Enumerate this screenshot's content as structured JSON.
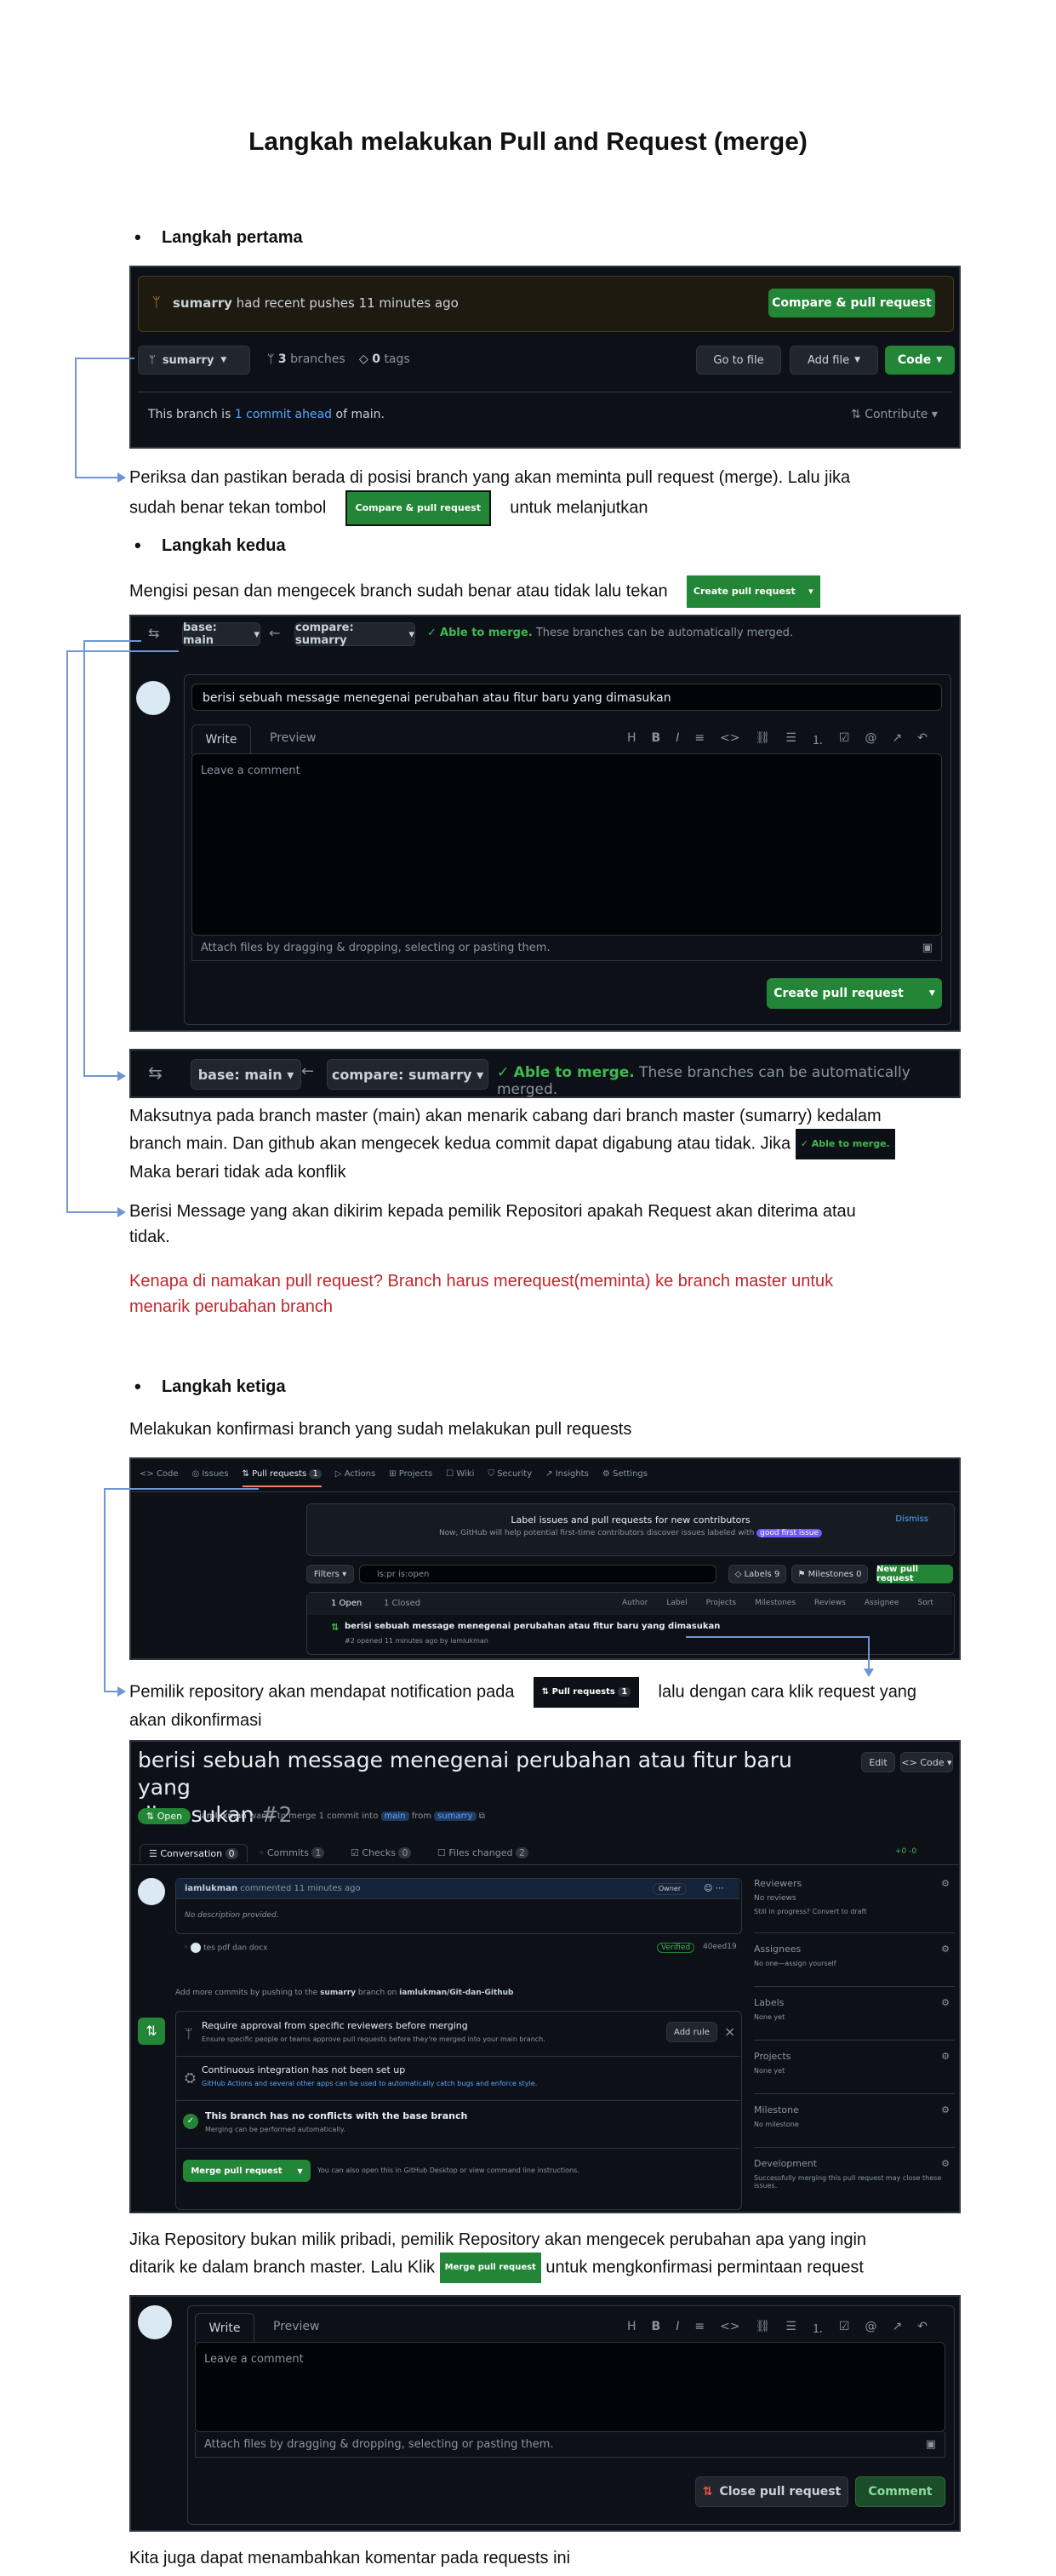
{
  "title": "Langkah melakukan Pull and Request (merge)",
  "step1": {
    "heading": "Langkah pertama",
    "screenshot": {
      "banner_branch": "sumarry",
      "banner_text": "had recent pushes 11 minutes ago",
      "compare_btn": "Compare & pull request",
      "branch_btn": "sumarry",
      "branches_count": "3",
      "branches_label": "branches",
      "tags_count": "0",
      "tags_label": "tags",
      "goto_file": "Go to file",
      "add_file": "Add file",
      "code_btn": "Code",
      "ahead_prefix": "This branch is",
      "ahead_link": "1 commit ahead",
      "ahead_suffix": "of main.",
      "contribute": "Contribute"
    },
    "desc_1": "Periksa dan pastikan berada di posisi branch yang akan meminta pull request (merge). Lalu jika",
    "desc_2a": "sudah benar tekan tombol",
    "inline_btn": "Compare & pull request",
    "desc_2b": "untuk melanjutkan"
  },
  "step2": {
    "heading": "Langkah kedua",
    "intro": "Mengisi pesan dan mengecek branch sudah benar atau tidak lalu tekan",
    "inline_btn": "Create pull request",
    "screenshot": {
      "base": "base: main",
      "compare": "compare: sumarry",
      "able": "Able to merge.",
      "able_rest": "These branches can be automatically merged.",
      "title_value": "berisi sebuah message menegenai perubahan atau fitur baru yang dimasukan",
      "tab_write": "Write",
      "tab_preview": "Preview",
      "placeholder": "Leave a comment",
      "attach": "Attach files by dragging & dropping, selecting or pasting them.",
      "create_btn": "Create pull request"
    },
    "zoom": {
      "base": "base: main",
      "compare": "compare: sumarry",
      "able": "Able to merge.",
      "able_rest": "These branches can be automatically merged."
    },
    "desc_1": "Maksutnya pada branch master (main) akan menarik cabang dari branch master (sumarry) kedalam",
    "desc_2": "branch main. Dan github akan mengecek kedua commit dapat digabung atau tidak. Jika",
    "inline_able": "Able to merge.",
    "desc_3": "Maka berari tidak ada konflik",
    "desc_4": "Berisi Message yang akan dikirim kepada pemilik Repositori apakah Request akan diterima atau",
    "desc_5": "tidak.",
    "red_1": "Kenapa di namakan pull request? Branch harus merequest(meminta) ke branch master untuk",
    "red_2": "menarik perubahan branch"
  },
  "step3": {
    "heading": "Langkah ketiga",
    "intro": "Melakukan konfirmasi branch yang sudah melakukan pull requests",
    "tabs": [
      "Code",
      "Issues",
      "Pull requests",
      "Actions",
      "Projects",
      "Wiki",
      "Security",
      "Insights",
      "Settings"
    ],
    "pr_count": "1",
    "banner_title": "Label issues and pull requests for new contributors",
    "banner_sub": "Now, GitHub will help potential first-time contributors discover issues labeled with",
    "banner_label": "good first issue",
    "dismiss": "Dismiss",
    "filters": "Filters",
    "search": "is:pr is:open",
    "labels": "Labels",
    "labels_count": "9",
    "milestones": "Milestones",
    "milestones_count": "0",
    "new_pr": "New pull request",
    "open_count": "1 Open",
    "closed_count": "1 Closed",
    "filter_cols": [
      "Author",
      "Label",
      "Projects",
      "Milestones",
      "Reviews",
      "Assignee",
      "Sort"
    ],
    "pr_title": "berisi sebuah message menegenai perubahan atau fitur baru yang dimasukan",
    "pr_meta": "#2 opened 11 minutes ago by iamlukman",
    "desc_1a": "Pemilik repository akan mendapat notification pada",
    "inline_pr": "Pull requests",
    "inline_pr_count": "1",
    "desc_1b": "lalu dengan cara klik request yang",
    "desc_2": "akan dikonfirmasi"
  },
  "prpage": {
    "title_1": "berisi sebuah message menegenai perubahan atau fitur baru yang",
    "title_2": "dimasukan",
    "number": "#2",
    "edit": "Edit",
    "code": "Code",
    "status": "Open",
    "meta_user": "iamlukman",
    "meta_text": "wants to merge 1 commit into",
    "base": "main",
    "from": "from",
    "head": "sumarry",
    "tabs": [
      {
        "label": "Conversation",
        "count": "0"
      },
      {
        "label": "Commits",
        "count": "1"
      },
      {
        "label": "Checks",
        "count": "0"
      },
      {
        "label": "Files changed",
        "count": "2"
      }
    ],
    "diff": "+0 -0",
    "comment_user": "iamlukman",
    "comment_meta": "commented 11 minutes ago",
    "owner": "Owner",
    "no_desc": "No description provided.",
    "commit_msg": "tes pdf dan docx",
    "verified": "Verified",
    "sha": "40eed19",
    "hint": "Add more commits by pushing to the",
    "hint_branch": "sumarry",
    "hint_tail": "branch on",
    "hint_repo": "iamlukman/Git-dan-Github",
    "review_title": "Require approval from specific reviewers before merging",
    "review_sub": "Ensure specific people or teams approve pull requests before they're merged into your main branch.",
    "add_rule": "Add rule",
    "ci_title": "Continuous integration has not been set up",
    "ci_sub": "GitHub Actions and several other apps can be used to automatically catch bugs and enforce style.",
    "noconf_title": "This branch has no conflicts with the base branch",
    "noconf_sub": "Merging can be performed automatically.",
    "merge_btn": "Merge pull request",
    "merge_hint": "You can also open this in GitHub Desktop or view command line instructions.",
    "sidebar": [
      {
        "label": "Reviewers",
        "value": "No reviews",
        "extra": "Still in progress? Convert to draft"
      },
      {
        "label": "Assignees",
        "value": "No one—assign yourself",
        "extra": ""
      },
      {
        "label": "Labels",
        "value": "None yet",
        "extra": ""
      },
      {
        "label": "Projects",
        "value": "None yet",
        "extra": ""
      },
      {
        "label": "Milestone",
        "value": "No milestone",
        "extra": ""
      },
      {
        "label": "Development",
        "value": "Successfully merging this pull request may close these issues.",
        "extra": ""
      }
    ],
    "desc_1": "Jika Repository bukan milik pribadi, pemilik Repository akan mengecek perubahan apa yang ingin",
    "desc_2a": "ditarik ke dalam branch master. Lalu Klik",
    "inline_btn": "Merge pull request",
    "desc_2b": "untuk mengkonfirmasi permintaan request"
  },
  "comment": {
    "tab_write": "Write",
    "tab_preview": "Preview",
    "placeholder": "Leave a comment",
    "attach": "Attach files by dragging & dropping, selecting or pasting them.",
    "close_btn": "Close pull request",
    "comment_btn": "Comment",
    "final": "Kita juga dapat menambahkan komentar pada requests ini"
  }
}
